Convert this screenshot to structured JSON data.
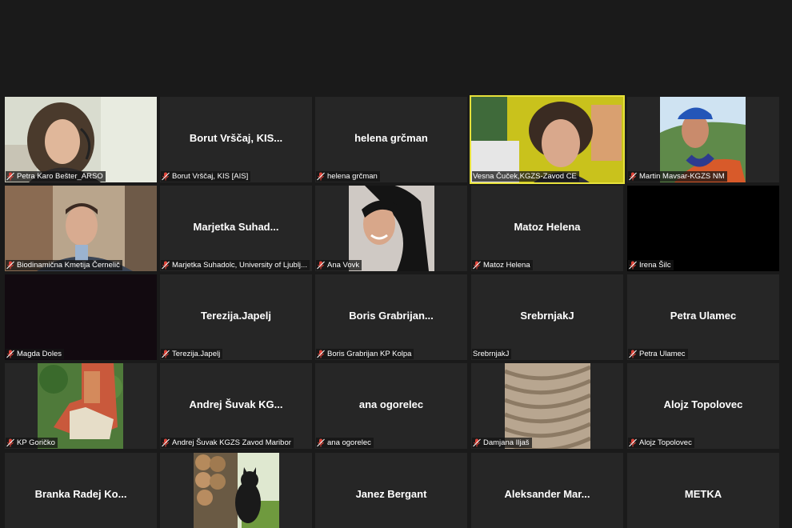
{
  "meeting": {
    "tiles": [
      {
        "name": "Petra Karo Bešter_ARSO",
        "display": "",
        "muted": true
      },
      {
        "name": "Borut Vrščaj, KIS [AIS]",
        "display": "Borut Vrščaj, KIS...",
        "muted": true
      },
      {
        "name": "helena grčman",
        "display": "helena grčman",
        "muted": true
      },
      {
        "name": "Vesna Čuček,KGZS-Zavod CE",
        "display": "",
        "muted": false
      },
      {
        "name": "Martin Mavsar-KGZS NM",
        "display": "",
        "muted": true
      },
      {
        "name": "Biodinamična Kmetija Černelič",
        "display": "",
        "muted": true
      },
      {
        "name": "Marjetka Suhadolc, University of Ljublj...",
        "display": "Marjetka Suhad...",
        "muted": true
      },
      {
        "name": "Ana Vovk",
        "display": "",
        "muted": true
      },
      {
        "name": "Matoz Helena",
        "display": "Matoz Helena",
        "muted": true
      },
      {
        "name": "Irena Šilc",
        "display": "",
        "muted": true
      },
      {
        "name": "Magda Doles",
        "display": "",
        "muted": true
      },
      {
        "name": "Terezija.Japelj",
        "display": "Terezija.Japelj",
        "muted": true
      },
      {
        "name": "Boris Grabrijan KP Kolpa",
        "display": "Boris Grabrijan...",
        "muted": true
      },
      {
        "name": "SrebrnjakJ",
        "display": "SrebrnjakJ",
        "muted": false
      },
      {
        "name": "Petra Ulamec",
        "display": "Petra Ulamec",
        "muted": true
      },
      {
        "name": "KP Goričko",
        "display": "",
        "muted": true
      },
      {
        "name": "Andrej Šuvak KGZS Zavod Maribor",
        "display": "Andrej Šuvak KG...",
        "muted": true
      },
      {
        "name": "ana ogorelec",
        "display": "ana ogorelec",
        "muted": true
      },
      {
        "name": "Damjana Iljaš",
        "display": "",
        "muted": true
      },
      {
        "name": "Alojz Topolovec",
        "display": "Alojz Topolovec",
        "muted": true
      },
      {
        "name": "",
        "display": "Branka Radej Ko...",
        "muted": false
      },
      {
        "name": "",
        "display": "",
        "muted": false
      },
      {
        "name": "",
        "display": "Janez Bergant",
        "muted": false
      },
      {
        "name": "",
        "display": "Aleksander Mar...",
        "muted": false
      },
      {
        "name": "",
        "display": "METKA",
        "muted": false
      }
    ]
  },
  "colors": {
    "background": "#1a1a1a",
    "tile": "#262626",
    "active_speaker_border": "#e6e03a",
    "mute_icon": "#e0453a"
  },
  "icons": {
    "muted": "microphone-muted-icon"
  }
}
